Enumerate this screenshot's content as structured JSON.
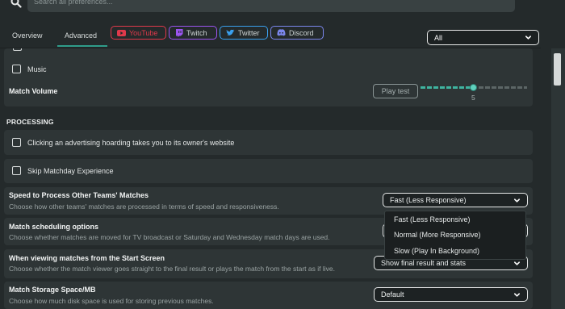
{
  "search": {
    "placeholder": "Search all preferences..."
  },
  "tabs": [
    {
      "label": "Overview"
    },
    {
      "label": "Advanced"
    }
  ],
  "social": [
    {
      "label": "YouTube",
      "color": "#e0394b"
    },
    {
      "label": "Twitch",
      "color": "#9b55f0"
    },
    {
      "label": "Twitter",
      "color": "#3aa0ee"
    },
    {
      "label": "Discord",
      "color": "#7b87ee"
    }
  ],
  "filter": {
    "value": "All"
  },
  "audio": {
    "music_label": "Music",
    "match_volume_label": "Match Volume",
    "play_test_label": "Play test",
    "volume_value": "5",
    "volume_fraction": 0.5
  },
  "processing": {
    "section_title": "PROCESSING",
    "hoarding_label": "Clicking an advertising hoarding takes you to its owner's website",
    "skip_matchday_label": "Skip Matchday Experience",
    "speed": {
      "title": "Speed to Process Other Teams' Matches",
      "desc": "Choose how other teams' matches are processed in terms of speed and responsiveness.",
      "value": "Fast (Less Responsive)",
      "options": [
        "Fast (Less Responsive)",
        "Normal (More Responsive)",
        "Slow (Play In Background)"
      ]
    },
    "scheduling": {
      "title": "Match scheduling options",
      "desc": "Choose whether matches are moved for TV broadcast or Saturday and Wednesday match days are used."
    },
    "viewing": {
      "title": "When viewing matches from the Start Screen",
      "desc": "Choose whether the match viewer goes straight to the final result or plays the match from the start as if live.",
      "value": "Show final result and stats"
    },
    "storage": {
      "title": "Match Storage Space/MB",
      "desc": "Choose how much disk space is used for storing previous matches.",
      "value": "Default"
    }
  }
}
